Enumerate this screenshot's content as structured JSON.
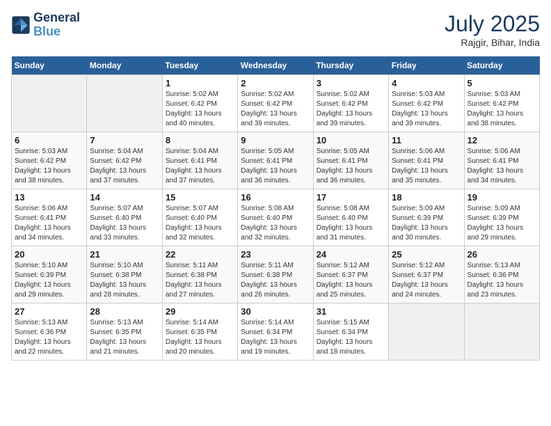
{
  "header": {
    "logo_line1": "General",
    "logo_line2": "Blue",
    "month": "July 2025",
    "location": "Rajgir, Bihar, India"
  },
  "days_of_week": [
    "Sunday",
    "Monday",
    "Tuesday",
    "Wednesday",
    "Thursday",
    "Friday",
    "Saturday"
  ],
  "weeks": [
    [
      {
        "day": "",
        "empty": true
      },
      {
        "day": "",
        "empty": true
      },
      {
        "day": "1",
        "sunrise": "5:02 AM",
        "sunset": "6:42 PM",
        "daylight": "13 hours and 40 minutes."
      },
      {
        "day": "2",
        "sunrise": "5:02 AM",
        "sunset": "6:42 PM",
        "daylight": "13 hours and 39 minutes."
      },
      {
        "day": "3",
        "sunrise": "5:02 AM",
        "sunset": "6:42 PM",
        "daylight": "13 hours and 39 minutes."
      },
      {
        "day": "4",
        "sunrise": "5:03 AM",
        "sunset": "6:42 PM",
        "daylight": "13 hours and 39 minutes."
      },
      {
        "day": "5",
        "sunrise": "5:03 AM",
        "sunset": "6:42 PM",
        "daylight": "13 hours and 38 minutes."
      }
    ],
    [
      {
        "day": "6",
        "sunrise": "5:03 AM",
        "sunset": "6:42 PM",
        "daylight": "13 hours and 38 minutes."
      },
      {
        "day": "7",
        "sunrise": "5:04 AM",
        "sunset": "6:42 PM",
        "daylight": "13 hours and 37 minutes."
      },
      {
        "day": "8",
        "sunrise": "5:04 AM",
        "sunset": "6:41 PM",
        "daylight": "13 hours and 37 minutes."
      },
      {
        "day": "9",
        "sunrise": "5:05 AM",
        "sunset": "6:41 PM",
        "daylight": "13 hours and 36 minutes."
      },
      {
        "day": "10",
        "sunrise": "5:05 AM",
        "sunset": "6:41 PM",
        "daylight": "13 hours and 36 minutes."
      },
      {
        "day": "11",
        "sunrise": "5:06 AM",
        "sunset": "6:41 PM",
        "daylight": "13 hours and 35 minutes."
      },
      {
        "day": "12",
        "sunrise": "5:06 AM",
        "sunset": "6:41 PM",
        "daylight": "13 hours and 34 minutes."
      }
    ],
    [
      {
        "day": "13",
        "sunrise": "5:06 AM",
        "sunset": "6:41 PM",
        "daylight": "13 hours and 34 minutes."
      },
      {
        "day": "14",
        "sunrise": "5:07 AM",
        "sunset": "6:40 PM",
        "daylight": "13 hours and 33 minutes."
      },
      {
        "day": "15",
        "sunrise": "5:07 AM",
        "sunset": "6:40 PM",
        "daylight": "13 hours and 32 minutes."
      },
      {
        "day": "16",
        "sunrise": "5:08 AM",
        "sunset": "6:40 PM",
        "daylight": "13 hours and 32 minutes."
      },
      {
        "day": "17",
        "sunrise": "5:08 AM",
        "sunset": "6:40 PM",
        "daylight": "13 hours and 31 minutes."
      },
      {
        "day": "18",
        "sunrise": "5:09 AM",
        "sunset": "6:39 PM",
        "daylight": "13 hours and 30 minutes."
      },
      {
        "day": "19",
        "sunrise": "5:09 AM",
        "sunset": "6:39 PM",
        "daylight": "13 hours and 29 minutes."
      }
    ],
    [
      {
        "day": "20",
        "sunrise": "5:10 AM",
        "sunset": "6:39 PM",
        "daylight": "13 hours and 29 minutes."
      },
      {
        "day": "21",
        "sunrise": "5:10 AM",
        "sunset": "6:38 PM",
        "daylight": "13 hours and 28 minutes."
      },
      {
        "day": "22",
        "sunrise": "5:11 AM",
        "sunset": "6:38 PM",
        "daylight": "13 hours and 27 minutes."
      },
      {
        "day": "23",
        "sunrise": "5:11 AM",
        "sunset": "6:38 PM",
        "daylight": "13 hours and 26 minutes."
      },
      {
        "day": "24",
        "sunrise": "5:12 AM",
        "sunset": "6:37 PM",
        "daylight": "13 hours and 25 minutes."
      },
      {
        "day": "25",
        "sunrise": "5:12 AM",
        "sunset": "6:37 PM",
        "daylight": "13 hours and 24 minutes."
      },
      {
        "day": "26",
        "sunrise": "5:13 AM",
        "sunset": "6:36 PM",
        "daylight": "13 hours and 23 minutes."
      }
    ],
    [
      {
        "day": "27",
        "sunrise": "5:13 AM",
        "sunset": "6:36 PM",
        "daylight": "13 hours and 22 minutes."
      },
      {
        "day": "28",
        "sunrise": "5:13 AM",
        "sunset": "6:35 PM",
        "daylight": "13 hours and 21 minutes."
      },
      {
        "day": "29",
        "sunrise": "5:14 AM",
        "sunset": "6:35 PM",
        "daylight": "13 hours and 20 minutes."
      },
      {
        "day": "30",
        "sunrise": "5:14 AM",
        "sunset": "6:34 PM",
        "daylight": "13 hours and 19 minutes."
      },
      {
        "day": "31",
        "sunrise": "5:15 AM",
        "sunset": "6:34 PM",
        "daylight": "13 hours and 18 minutes."
      },
      {
        "day": "",
        "empty": true
      },
      {
        "day": "",
        "empty": true
      }
    ]
  ]
}
